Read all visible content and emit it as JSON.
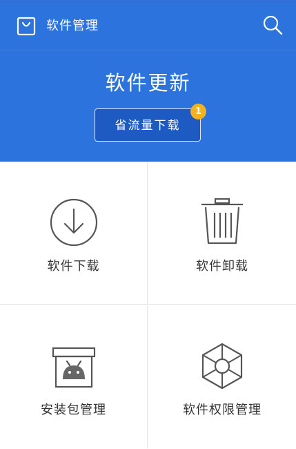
{
  "topbar": {
    "app_icon": "shopping-bag-icon",
    "title": "软件管理",
    "search_icon": "search-icon"
  },
  "hero": {
    "title": "软件更新",
    "button_label": "省流量下载",
    "badge_count": "1"
  },
  "grid": {
    "items": [
      {
        "label": "软件下载",
        "icon": "download-circle-icon"
      },
      {
        "label": "软件卸载",
        "icon": "trash-can-icon"
      },
      {
        "label": "安装包管理",
        "icon": "android-package-icon"
      },
      {
        "label": "软件权限管理",
        "icon": "hexagon-shield-icon"
      }
    ]
  },
  "colors": {
    "header_blue": "#2c73dd",
    "button_blue": "#1d5bc3",
    "badge_orange": "#f7b21b"
  }
}
